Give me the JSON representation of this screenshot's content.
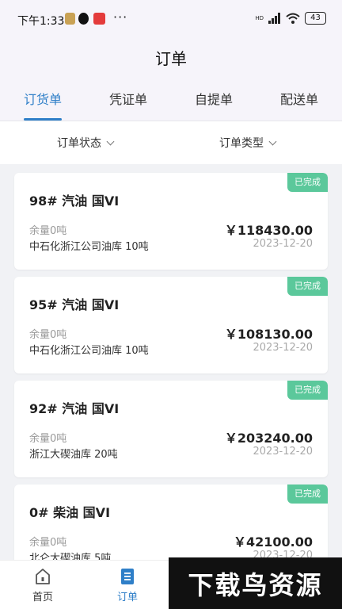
{
  "status_bar": {
    "time": "下午1:33",
    "dots": "···",
    "battery": "43",
    "network": "HD"
  },
  "header": {
    "title": "订单"
  },
  "tabs": [
    {
      "label": "订货单",
      "active": true
    },
    {
      "label": "凭证单",
      "active": false
    },
    {
      "label": "自提单",
      "active": false
    },
    {
      "label": "配送单",
      "active": false
    }
  ],
  "filters": [
    {
      "label": "订单状态"
    },
    {
      "label": "订单类型"
    }
  ],
  "orders": [
    {
      "product": "98# 汽油 国VI",
      "status": "已完成",
      "remaining": "余量0吨",
      "depot": "中石化浙江公司油库  10吨",
      "amount": "￥118430.00",
      "date": "2023-12-20"
    },
    {
      "product": "95# 汽油 国VI",
      "status": "已完成",
      "remaining": "余量0吨",
      "depot": "中石化浙江公司油库  10吨",
      "amount": "￥108130.00",
      "date": "2023-12-20"
    },
    {
      "product": "92# 汽油 国VI",
      "status": "已完成",
      "remaining": "余量0吨",
      "depot": "浙江大碶油库  20吨",
      "amount": "￥203240.00",
      "date": "2023-12-20"
    },
    {
      "product": "0# 柴油 国VI",
      "status": "已完成",
      "remaining": "余量0吨",
      "depot": "北仑大碶油库  5吨",
      "amount": "￥42100.00",
      "date": "2023-12-20"
    }
  ],
  "bottom_nav": [
    {
      "label": "首页",
      "icon": "home-icon",
      "active": false
    },
    {
      "label": "订单",
      "icon": "order-icon",
      "active": true
    }
  ],
  "watermark": {
    "text": "下载鸟资源"
  },
  "colors": {
    "accent": "#2f7fc8",
    "badge": "#5bc89b"
  }
}
